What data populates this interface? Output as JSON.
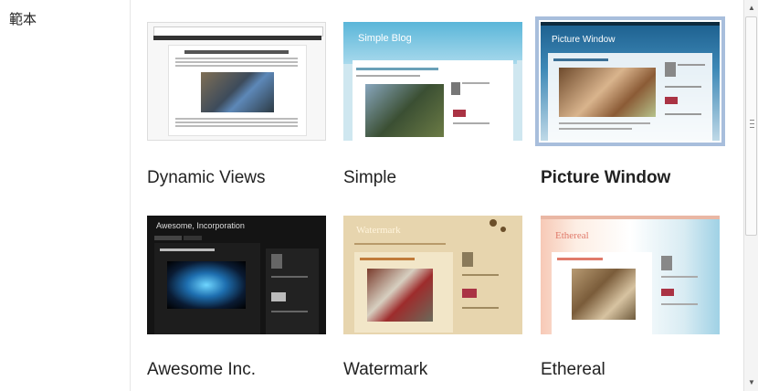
{
  "section_label": "範本",
  "templates": [
    {
      "name": "Dynamic Views",
      "selected": false
    },
    {
      "name": "Simple",
      "selected": false,
      "thumb_title": "Simple Blog"
    },
    {
      "name": "Picture Window",
      "selected": true,
      "thumb_title": "Picture Window"
    },
    {
      "name": "Awesome Inc.",
      "selected": false,
      "thumb_title": "Awesome, Incorporation"
    },
    {
      "name": "Watermark",
      "selected": false,
      "thumb_title": "Watermark"
    },
    {
      "name": "Ethereal",
      "selected": false,
      "thumb_title": "Ethereal"
    }
  ],
  "scrollbar": {
    "up_icon": "arrow-up-icon",
    "down_icon": "arrow-down-icon",
    "up_glyph": "▲",
    "down_glyph": "▼"
  }
}
